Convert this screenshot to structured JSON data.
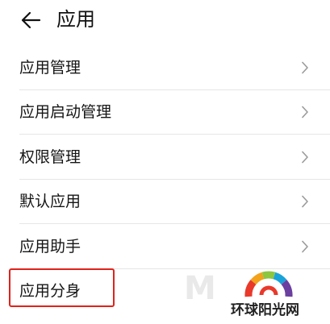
{
  "header": {
    "title": "应用",
    "back_icon": "arrow-left-icon"
  },
  "items": [
    {
      "label": "应用管理",
      "icon": "chevron-right-icon"
    },
    {
      "label": "应用启动管理",
      "icon": "chevron-right-icon"
    },
    {
      "label": "权限管理",
      "icon": "chevron-right-icon"
    },
    {
      "label": "默认应用",
      "icon": "chevron-right-icon"
    },
    {
      "label": "应用助手",
      "icon": "chevron-right-icon"
    },
    {
      "label": "应用分身"
    }
  ],
  "annotation": {
    "highlight_color": "#e0221b"
  },
  "watermark": {
    "text": "环球阳光网",
    "mark_text": "M"
  }
}
